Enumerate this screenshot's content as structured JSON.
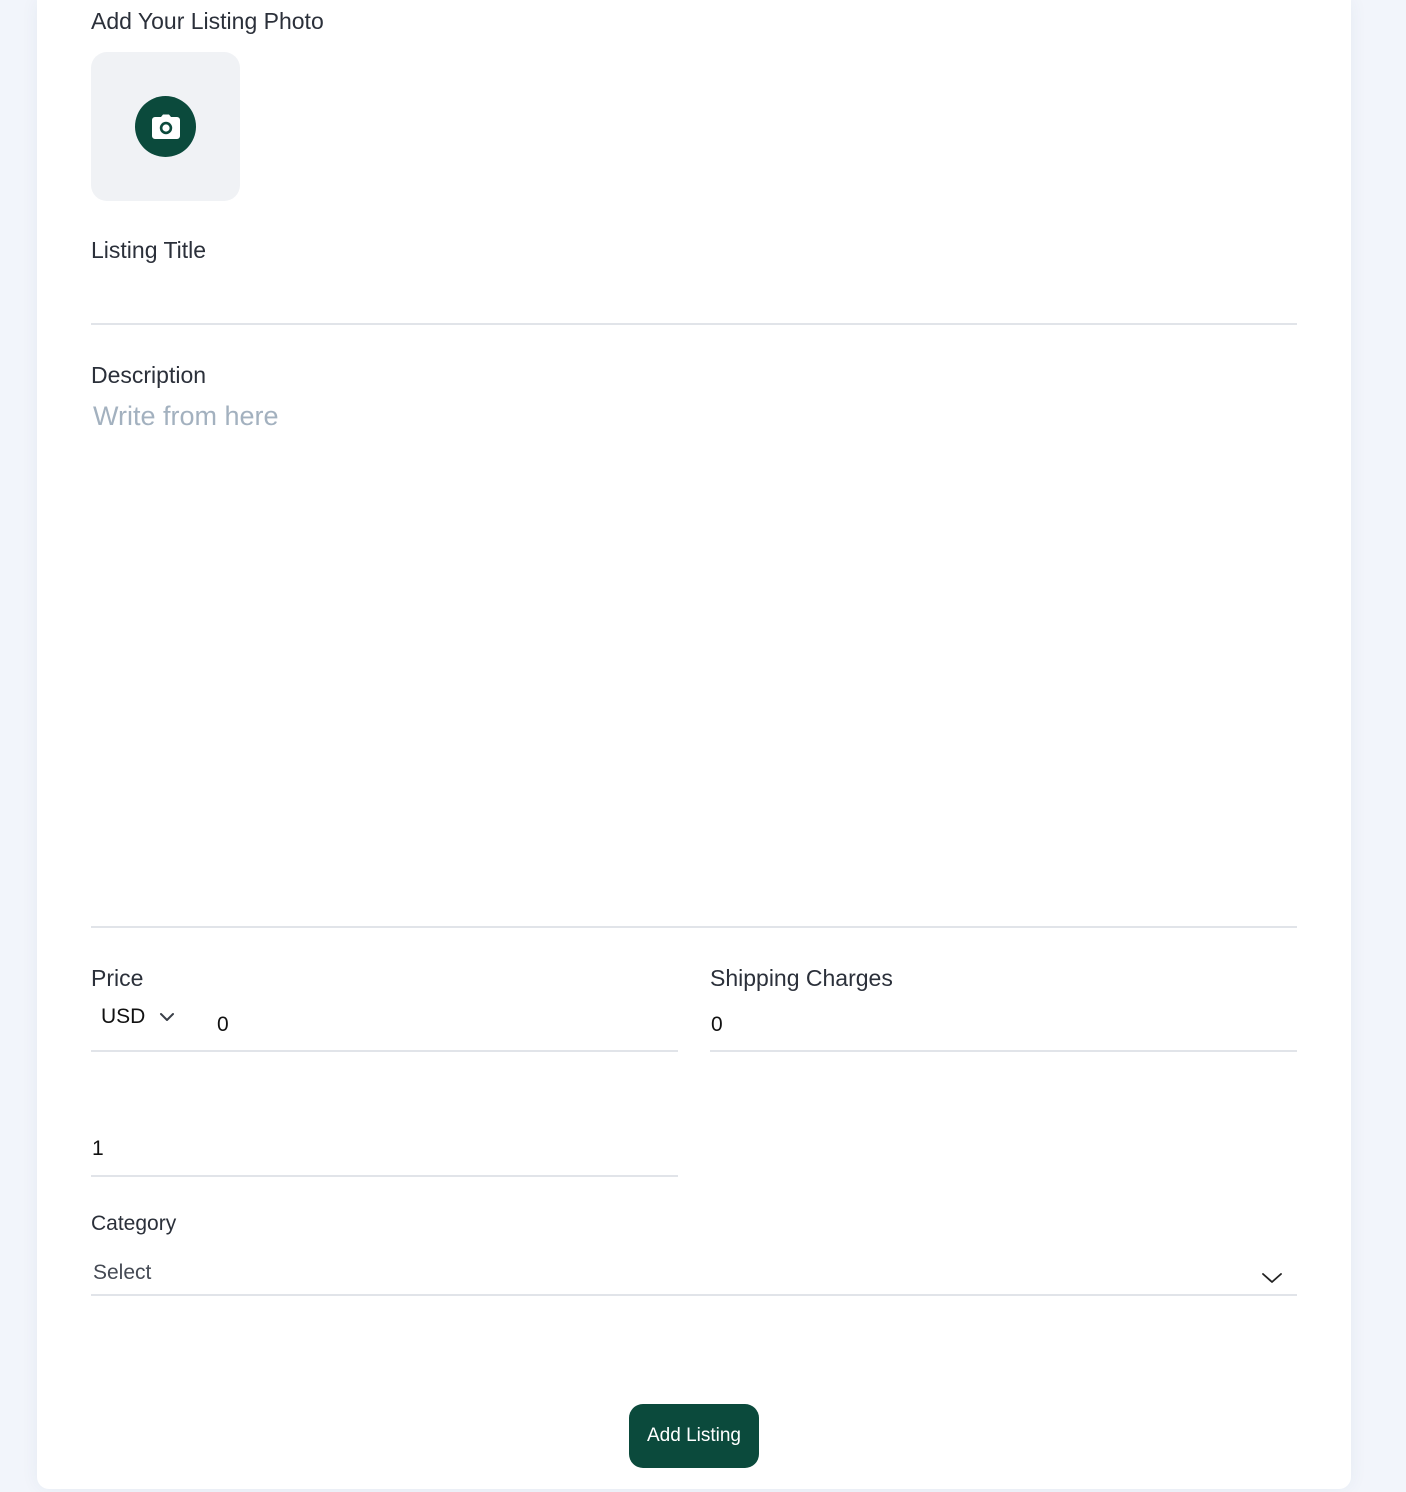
{
  "form": {
    "photo_label": "Add Your Listing Photo",
    "title_label": "Listing Title",
    "title_value": "",
    "description_label": "Description",
    "description_placeholder": "Write from here",
    "price_label": "Price",
    "currency": "USD",
    "price_value": "0",
    "shipping_label": "Shipping Charges",
    "shipping_value": "0",
    "quantity_value": "1",
    "category_label": "Category",
    "category_selected": "Select",
    "submit_label": "Add Listing"
  },
  "colors": {
    "accent": "#0b4a3c",
    "placeholder": "#a3b1bf",
    "divider": "#e1e4e9",
    "photo_box": "#f0f2f5"
  },
  "icons": {
    "photo": "camera-icon",
    "currency_toggle": "chevron-down-icon",
    "category_toggle": "chevron-down-icon"
  }
}
